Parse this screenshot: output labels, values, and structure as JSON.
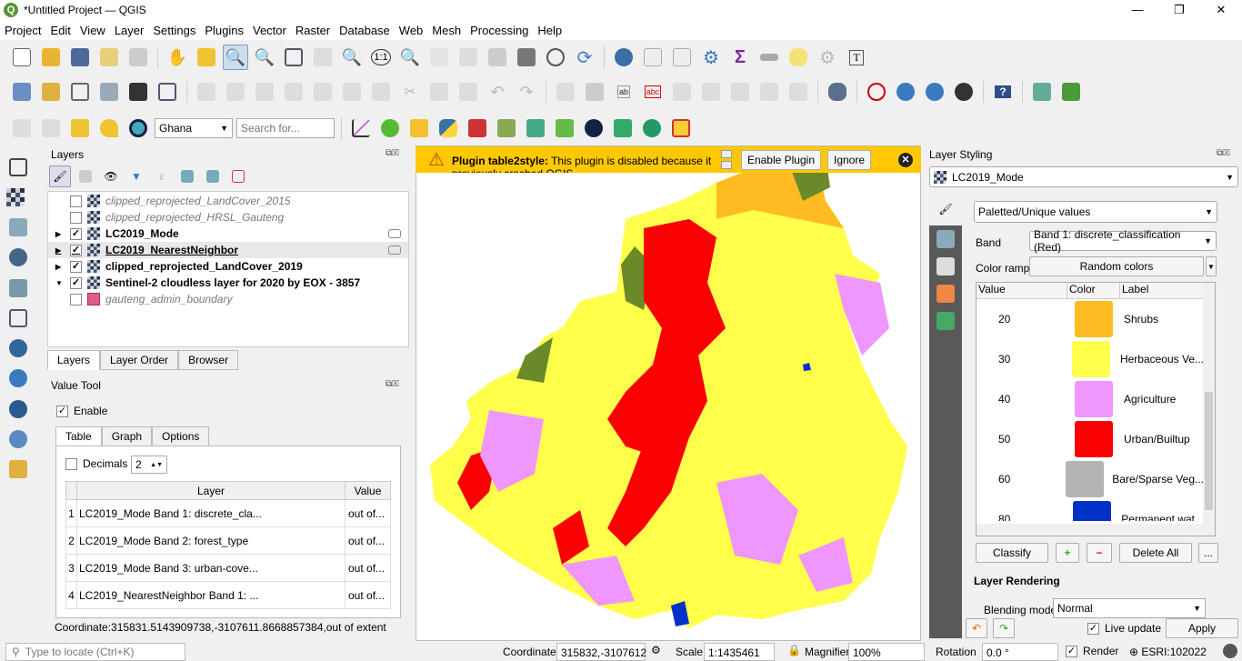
{
  "window": {
    "title": "*Untitled Project — QGIS",
    "min": "—",
    "max": "❐",
    "close": "✕"
  },
  "menu": [
    "Project",
    "Edit",
    "View",
    "Layer",
    "Settings",
    "Plugins",
    "Vector",
    "Raster",
    "Database",
    "Web",
    "Mesh",
    "Processing",
    "Help"
  ],
  "toolbar3": {
    "locator_value": "Ghana",
    "search_placeholder": "Search for..."
  },
  "layers_panel": {
    "title": "Layers",
    "tabs": [
      "Layers",
      "Layer Order",
      "Browser"
    ],
    "items": [
      {
        "name": "clipped_reprojected_LandCover_2015",
        "checked": false,
        "style": "italic-gray"
      },
      {
        "name": "clipped_reprojected_HRSL_Gauteng",
        "checked": false,
        "style": "italic-gray"
      },
      {
        "name": "LC2019_Mode",
        "checked": true,
        "style": "bold"
      },
      {
        "name": "LC2019_NearestNeighbor",
        "checked": true,
        "style": "bold-underline"
      },
      {
        "name": "clipped_reprojected_LandCover_2019",
        "checked": true,
        "style": "bold"
      },
      {
        "name": "Sentinel-2 cloudless layer for 2020 by EOX - 3857",
        "checked": true,
        "style": "bold"
      },
      {
        "name": "gauteng_admin_boundary",
        "checked": false,
        "style": "italic-gray"
      }
    ]
  },
  "value_tool": {
    "title": "Value Tool",
    "enable_label": "Enable",
    "tabs": [
      "Table",
      "Graph",
      "Options"
    ],
    "decimals_label": "Decimals",
    "decimals_value": "2",
    "columns": [
      "Layer",
      "Value"
    ],
    "rows": [
      {
        "n": "1",
        "layer": "LC2019_Mode Band 1: discrete_cla...",
        "value": "out of..."
      },
      {
        "n": "2",
        "layer": "LC2019_Mode Band 2: forest_type",
        "value": "out of..."
      },
      {
        "n": "3",
        "layer": "LC2019_Mode Band 3: urban-cove...",
        "value": "out of..."
      },
      {
        "n": "4",
        "layer": "LC2019_NearestNeighbor Band 1: ...",
        "value": "out of..."
      }
    ]
  },
  "coordinate_readout": "Coordinate:315831.5143909738,-3107611.8668857384,out of extent",
  "message_bar": {
    "title": "Plugin table2style:",
    "text": "This plugin is disabled because it previously crashed QGIS",
    "enable": "Enable Plugin",
    "ignore": "Ignore"
  },
  "styling": {
    "title": "Layer Styling",
    "layer": "LC2019_Mode",
    "renderer": "Paletted/Unique values",
    "band_label": "Band",
    "band": "Band 1: discrete_classification (Red)",
    "ramp_label": "Color ramp",
    "ramp": "Random colors",
    "columns": [
      "Value",
      "Color",
      "Label"
    ],
    "classes": [
      {
        "value": "20",
        "color": "#ffbb22",
        "label": "Shrubs"
      },
      {
        "value": "30",
        "color": "#ffff4c",
        "label": "Herbaceous Ve..."
      },
      {
        "value": "40",
        "color": "#f096ff",
        "label": "Agriculture"
      },
      {
        "value": "50",
        "color": "#fa0000",
        "label": "Urban/Builtup"
      },
      {
        "value": "60",
        "color": "#b4b4b4",
        "label": "Bare/Sparse Veg..."
      },
      {
        "value": "80",
        "color": "#0032c8",
        "label": "Permanent wat..."
      }
    ],
    "classify": "Classify",
    "add": "+",
    "remove": "−",
    "delete_all": "Delete All",
    "more": "...",
    "rendering_title": "Layer Rendering",
    "blending_label": "Blending mode",
    "blending": "Normal",
    "live_update": "Live update",
    "apply": "Apply"
  },
  "status": {
    "locate_placeholder": "Type to locate (Ctrl+K)",
    "coordinate_label": "Coordinate",
    "coordinate": "315832,-3107612",
    "scale_label": "Scale",
    "scale": "1:1435461",
    "magnifier_label": "Magnifier",
    "magnifier": "100%",
    "rotation_label": "Rotation",
    "rotation": "0.0 °",
    "render_label": "Render",
    "crs": "ESRI:102022"
  }
}
